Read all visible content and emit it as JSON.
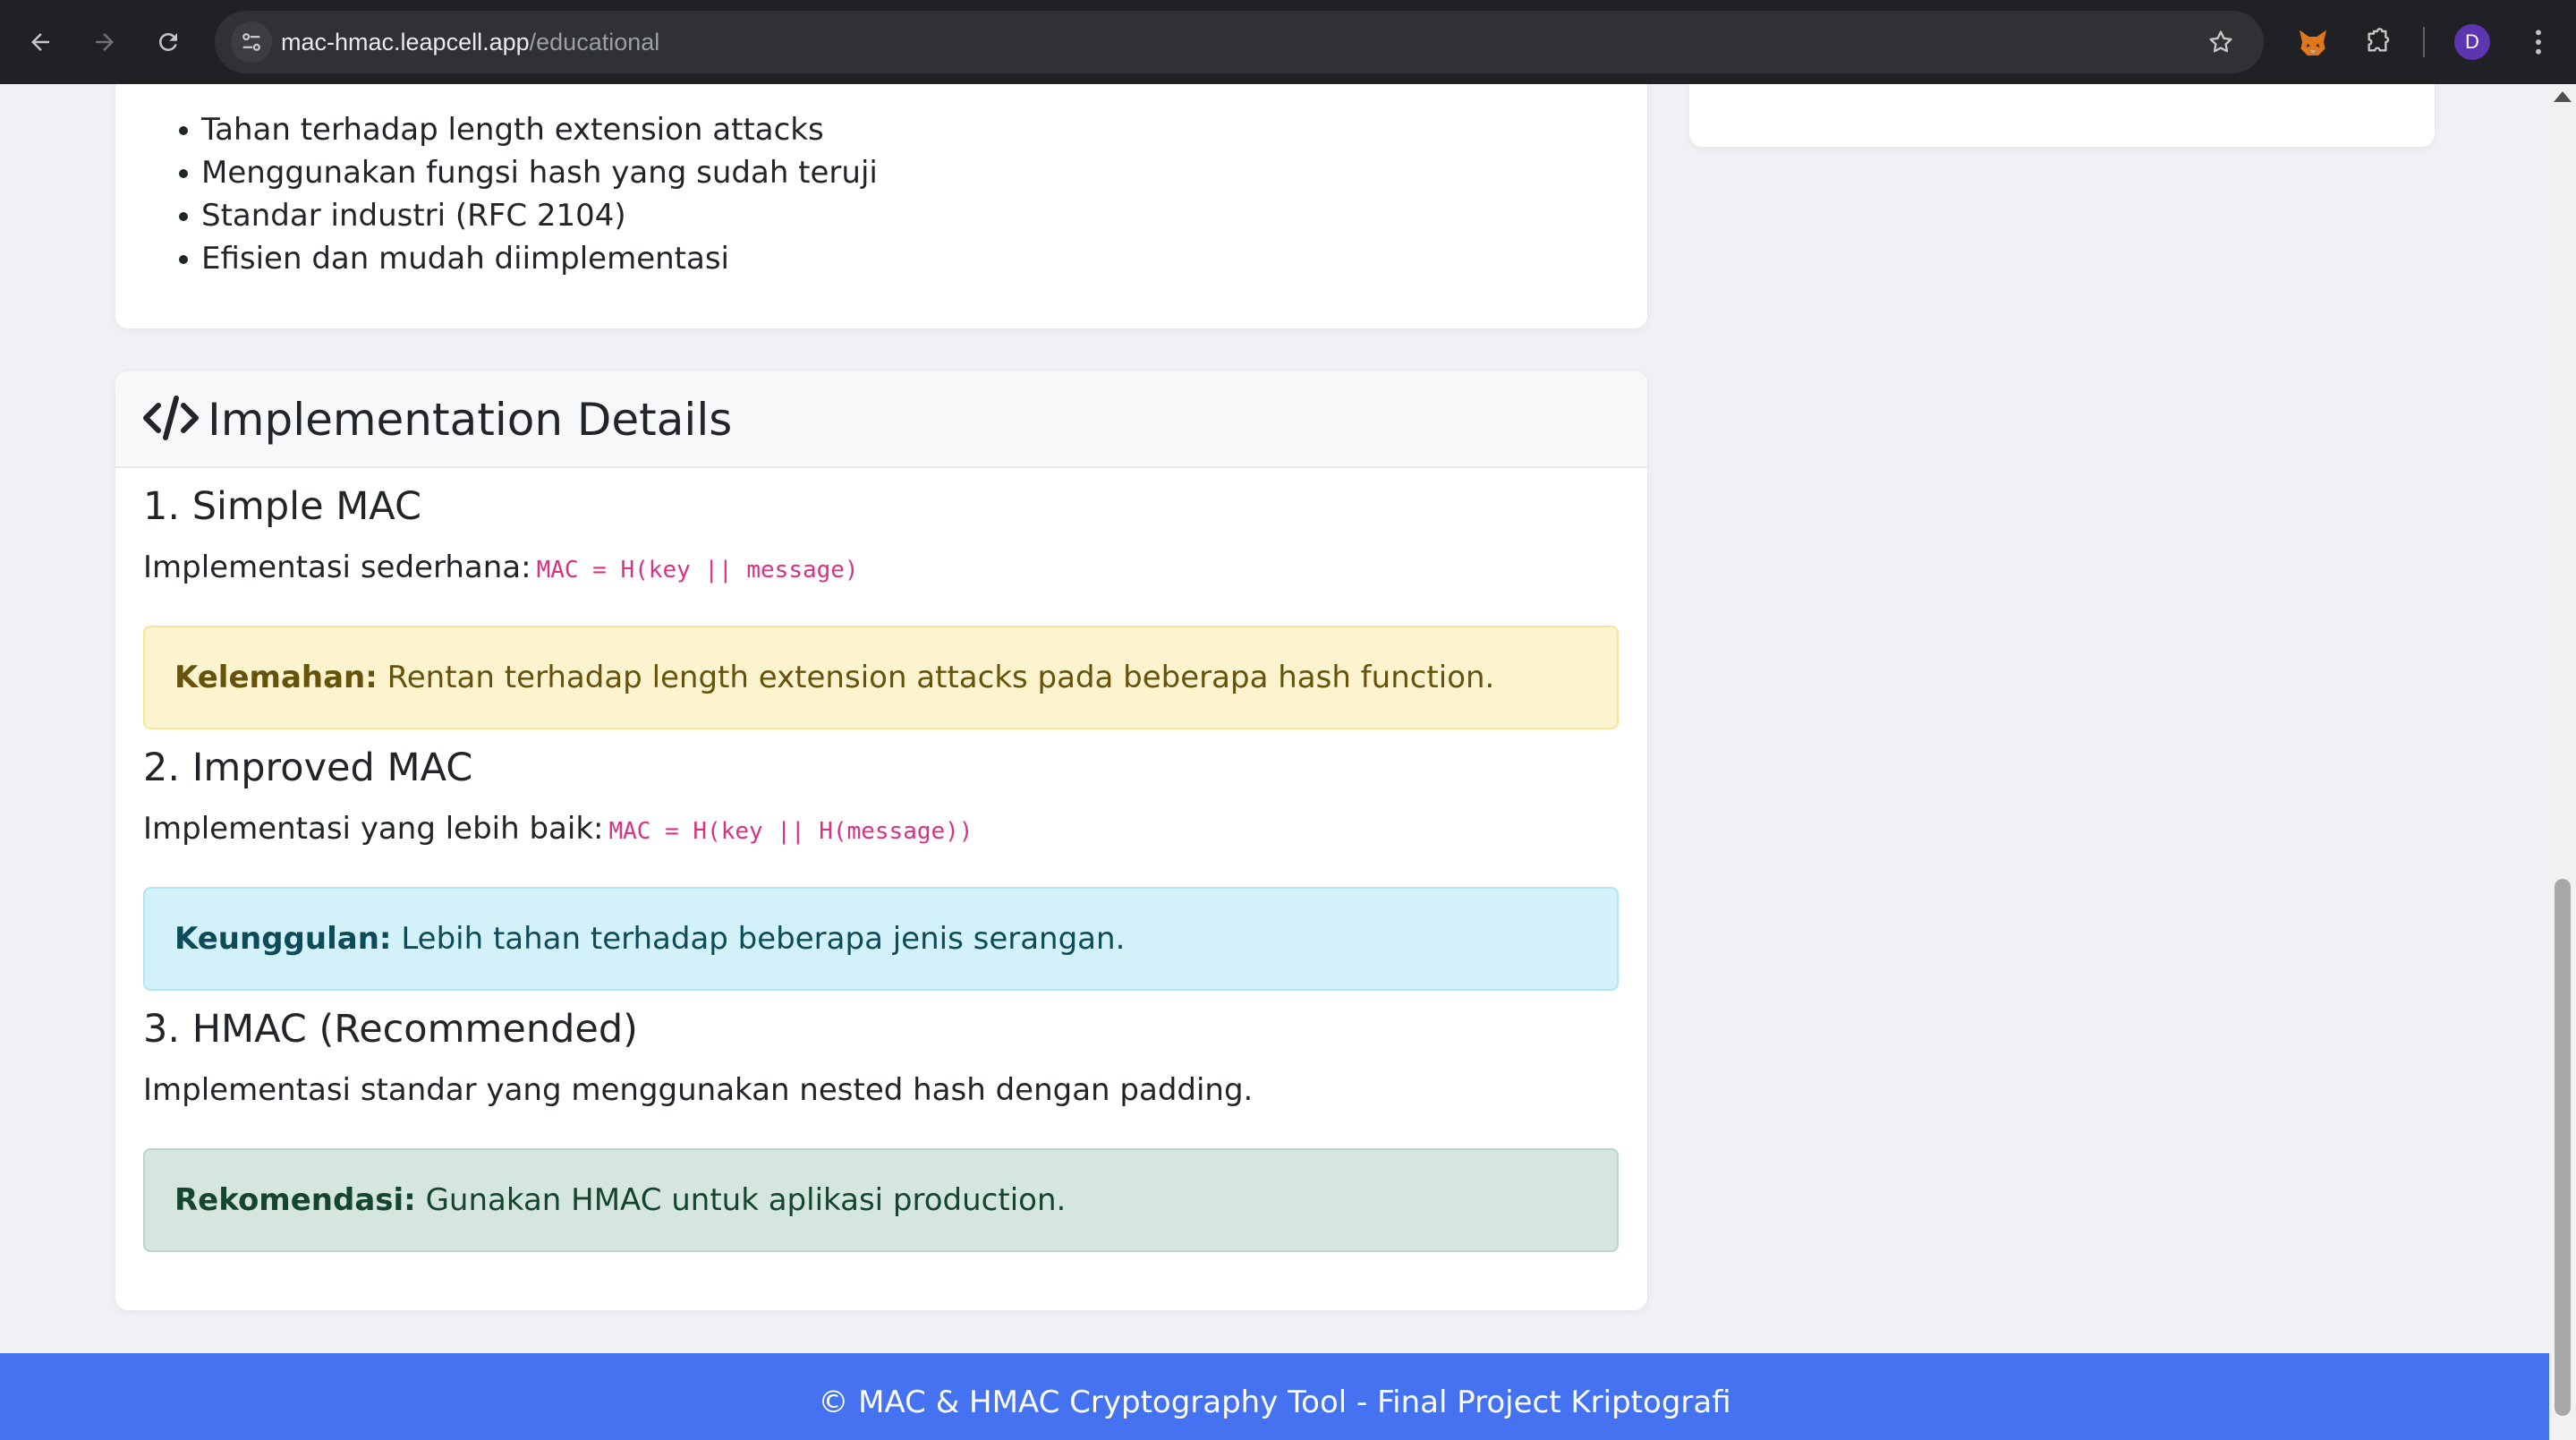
{
  "browser": {
    "url_host": "mac-hmac.leapcell.app",
    "url_path": "/educational",
    "avatar_letter": "D"
  },
  "benefits": {
    "items": [
      "Tahan terhadap length extension attacks",
      "Menggunakan fungsi hash yang sudah teruji",
      "Standar industri (RFC 2104)",
      "Efisien dan mudah diimplementasi"
    ]
  },
  "implementation": {
    "header_title": "Implementation Details",
    "simple": {
      "title": "1. Simple MAC",
      "text": "Implementasi sederhana:",
      "code": "MAC = H(key || message)",
      "alert_label": "Kelemahan:",
      "alert_text": "Rentan terhadap length extension attacks pada beberapa hash function."
    },
    "improved": {
      "title": "2. Improved MAC",
      "text": "Implementasi yang lebih baik:",
      "code": "MAC = H(key || H(message))",
      "alert_label": "Keunggulan:",
      "alert_text": "Lebih tahan terhadap beberapa jenis serangan."
    },
    "hmac": {
      "title": "3. HMAC (Recommended)",
      "text": "Implementasi standar yang menggunakan nested hash dengan padding.",
      "alert_label": "Rekomendasi:",
      "alert_text": "Gunakan HMAC untuk aplikasi production."
    }
  },
  "footer": {
    "text": "© MAC & HMAC Cryptography Tool - Final Project Kriptografi"
  },
  "colors": {
    "footer_bg": "#4472f0",
    "code": "#d63384",
    "warning_bg": "#fcf3cf",
    "info_bg": "#d3f1f8",
    "success_bg": "#d4e6de"
  }
}
